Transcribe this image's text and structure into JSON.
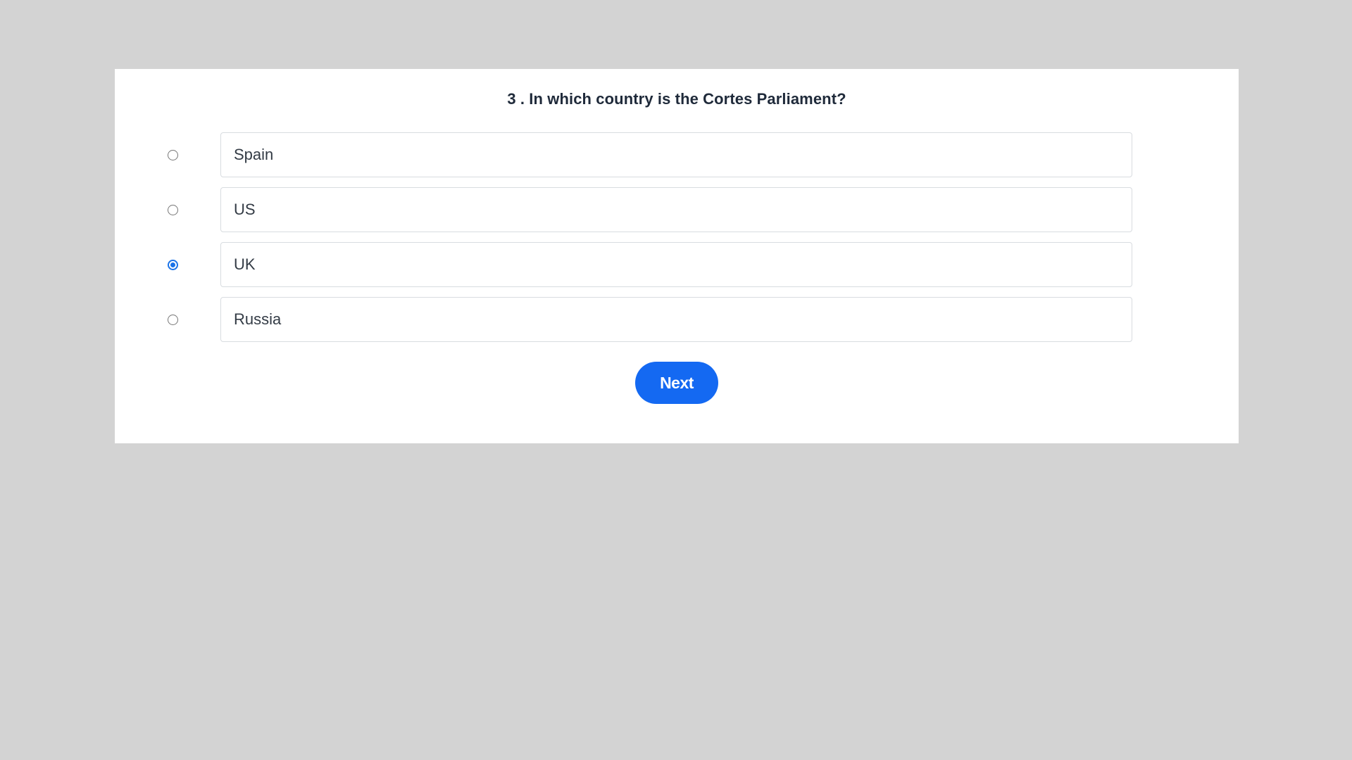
{
  "question": {
    "number": "3",
    "text": "3 . In which country is the Cortes Parliament?"
  },
  "options": [
    {
      "label": "Spain",
      "selected": false
    },
    {
      "label": "US",
      "selected": false
    },
    {
      "label": "UK",
      "selected": true
    },
    {
      "label": "Russia",
      "selected": false
    }
  ],
  "next_button": {
    "label": "Next"
  },
  "colors": {
    "background": "#d3d3d3",
    "card": "#ffffff",
    "accent": "#1469f2",
    "radio_selected": "#1a73e8",
    "text": "#333b45"
  }
}
